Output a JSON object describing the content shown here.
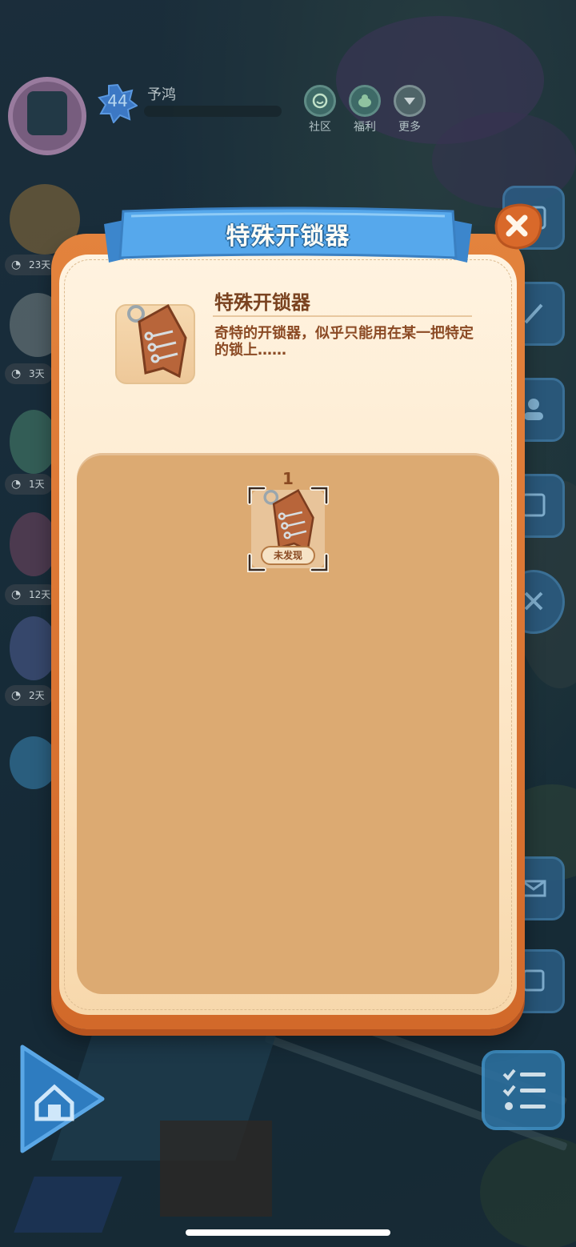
{
  "hud": {
    "player_name": "予鸿",
    "level": "44",
    "buttons": [
      {
        "label": "社区",
        "icon": "community-icon"
      },
      {
        "label": "福利",
        "icon": "welfare-icon"
      },
      {
        "label": "更多",
        "icon": "more-icon"
      }
    ]
  },
  "side_events": [
    {
      "timer": "23天"
    },
    {
      "timer": "3天"
    },
    {
      "timer": "1天"
    },
    {
      "timer": "12天"
    },
    {
      "timer": "2天"
    }
  ],
  "dialog": {
    "title": "特殊开锁器",
    "close_icon": "close-icon",
    "item": {
      "name": "特殊开锁器",
      "description": "奇特的开锁器，似乎只能用在某一把特定的锁上……",
      "icon": "lock-pick-kit-icon"
    },
    "collection": [
      {
        "count": "1",
        "status": "未发现",
        "icon": "lock-pick-kit-icon"
      }
    ]
  },
  "colors": {
    "banner_blue": "#4b9be0",
    "dialog_orange": "#e3833d",
    "panel_tan": "#dcaa72",
    "text_brown": "#7a4320"
  }
}
